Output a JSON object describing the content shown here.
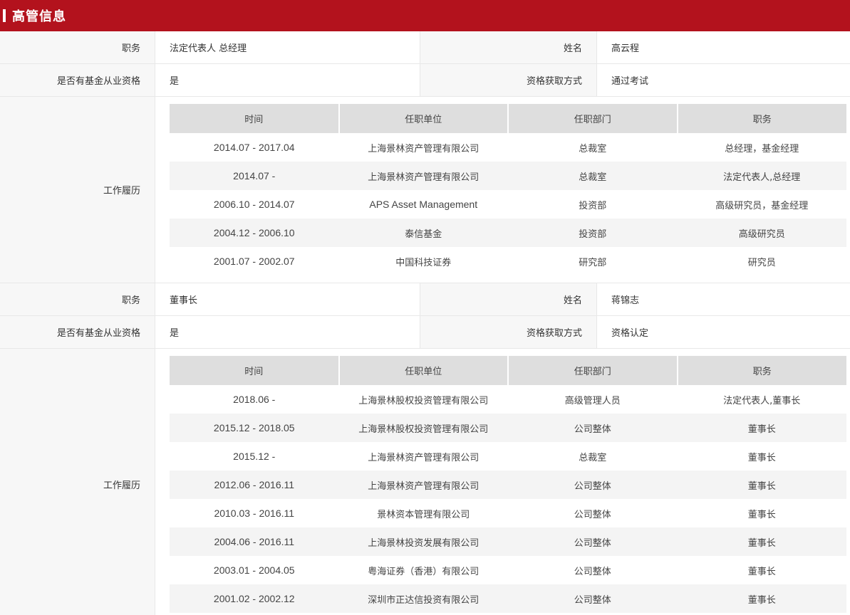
{
  "header": {
    "title": "高管信息"
  },
  "people": [
    {
      "position_label": "职务",
      "position_value": "法定代表人 总经理",
      "name_label": "姓名",
      "name_value": "高云程",
      "qual_label": "是否有基金从业资格",
      "qual_value": "是",
      "method_label": "资格获取方式",
      "method_value": "通过考试",
      "history_label": "工作履历",
      "columns": [
        "时间",
        "任职单位",
        "任职部门",
        "职务"
      ],
      "rows": [
        [
          "2014.07 - 2017.04",
          "上海景林资产管理有限公司",
          "总裁室",
          "总经理，基金经理"
        ],
        [
          "2014.07 -",
          "上海景林资产管理有限公司",
          "总裁室",
          "法定代表人,总经理"
        ],
        [
          "2006.10 - 2014.07",
          "APS Asset Management",
          "投资部",
          "高级研究员，基金经理"
        ],
        [
          "2004.12 - 2006.10",
          "泰信基金",
          "投资部",
          "高级研究员"
        ],
        [
          "2001.07 - 2002.07",
          "中国科技证券",
          "研究部",
          "研究员"
        ]
      ]
    },
    {
      "position_label": "职务",
      "position_value": "董事长",
      "name_label": "姓名",
      "name_value": "蒋锦志",
      "qual_label": "是否有基金从业资格",
      "qual_value": "是",
      "method_label": "资格获取方式",
      "method_value": "资格认定",
      "history_label": "工作履历",
      "columns": [
        "时间",
        "任职单位",
        "任职部门",
        "职务"
      ],
      "rows": [
        [
          "2018.06 -",
          "上海景林股权投资管理有限公司",
          "高级管理人员",
          "法定代表人,董事长"
        ],
        [
          "2015.12 - 2018.05",
          "上海景林股权投资管理有限公司",
          "公司整体",
          "董事长"
        ],
        [
          "2015.12 -",
          "上海景林资产管理有限公司",
          "总裁室",
          "董事长"
        ],
        [
          "2012.06 - 2016.11",
          "上海景林资产管理有限公司",
          "公司整体",
          "董事长"
        ],
        [
          "2010.03 - 2016.11",
          "景林资本管理有限公司",
          "公司整体",
          "董事长"
        ],
        [
          "2004.06 - 2016.11",
          "上海景林投资发展有限公司",
          "公司整体",
          "董事长"
        ],
        [
          "2003.01 - 2004.05",
          "粤海证券（香港）有限公司",
          "公司整体",
          "董事长"
        ],
        [
          "2001.02 - 2002.12",
          "深圳市正达信投资有限公司",
          "公司整体",
          "董事长"
        ]
      ]
    }
  ]
}
